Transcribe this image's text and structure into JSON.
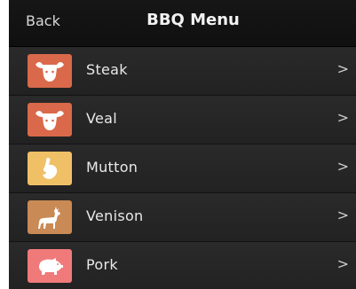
{
  "navbar": {
    "back_label": "Back",
    "title": "BBQ Menu"
  },
  "menu": {
    "items": [
      {
        "label": "Steak",
        "icon": "bull-head-icon",
        "color": "#d9694a",
        "chevron": ">"
      },
      {
        "label": "Veal",
        "icon": "bull-head-icon",
        "color": "#d9694a",
        "chevron": ">"
      },
      {
        "label": "Mutton",
        "icon": "lamb-leg-icon",
        "color": "#f0c067",
        "chevron": ">"
      },
      {
        "label": "Venison",
        "icon": "deer-icon",
        "color": "#c98a55",
        "chevron": ">"
      },
      {
        "label": "Pork",
        "icon": "pig-icon",
        "color": "#f07a7a",
        "chevron": ">"
      }
    ]
  }
}
